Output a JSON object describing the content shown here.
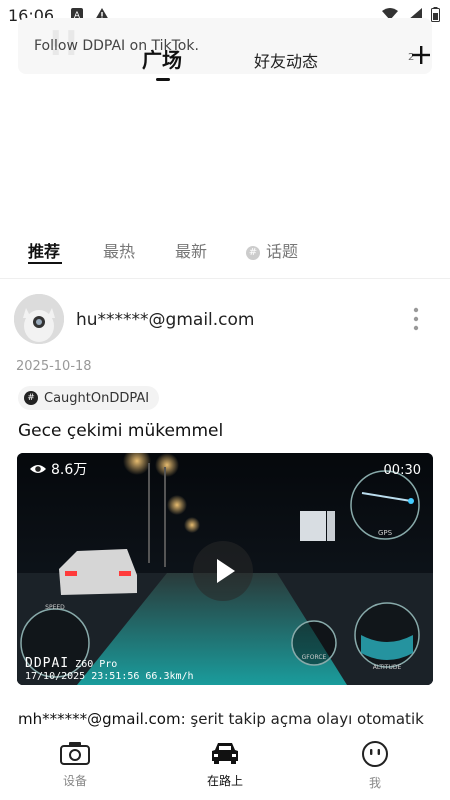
{
  "status_bar": {
    "time": "16:06"
  },
  "banner": {
    "ticker_text": "Follow DDPAI on TikTok."
  },
  "top_tabs": {
    "plaza": "广场",
    "friends": "好友动态",
    "small_digit": "2"
  },
  "sub_tabs": {
    "recommend": "推荐",
    "hot": "最热",
    "latest": "最新",
    "topics": "话题"
  },
  "post": {
    "username": "hu******@gmail.com",
    "date": "2025-10-18",
    "tag": "CaughtOnDDPAI",
    "caption": "Gece çekimi mükemmel",
    "video": {
      "views": "8.6万",
      "duration": "00:30",
      "watermark_brand": "DDPAI",
      "watermark_model": "Z60 Pro",
      "watermark_timestamp": "17/10/2025  23:51:56   66.3km/h",
      "gauge_speed": "SPEED",
      "gauge_gps": "GPS",
      "gauge_gforce": "GFORCE",
      "gauge_altitude": "ALTITUDE"
    }
  },
  "comment_preview": {
    "user": "mh******@gmail.com",
    "text": ": şerit takip açma olayı otomatik"
  },
  "bottom_nav": {
    "device": "设备",
    "on_road": "在路上",
    "me": "我"
  },
  "colors": {
    "active_text": "#111111",
    "inactive_text": "#888888",
    "chip_bg": "#f3f3f3"
  }
}
